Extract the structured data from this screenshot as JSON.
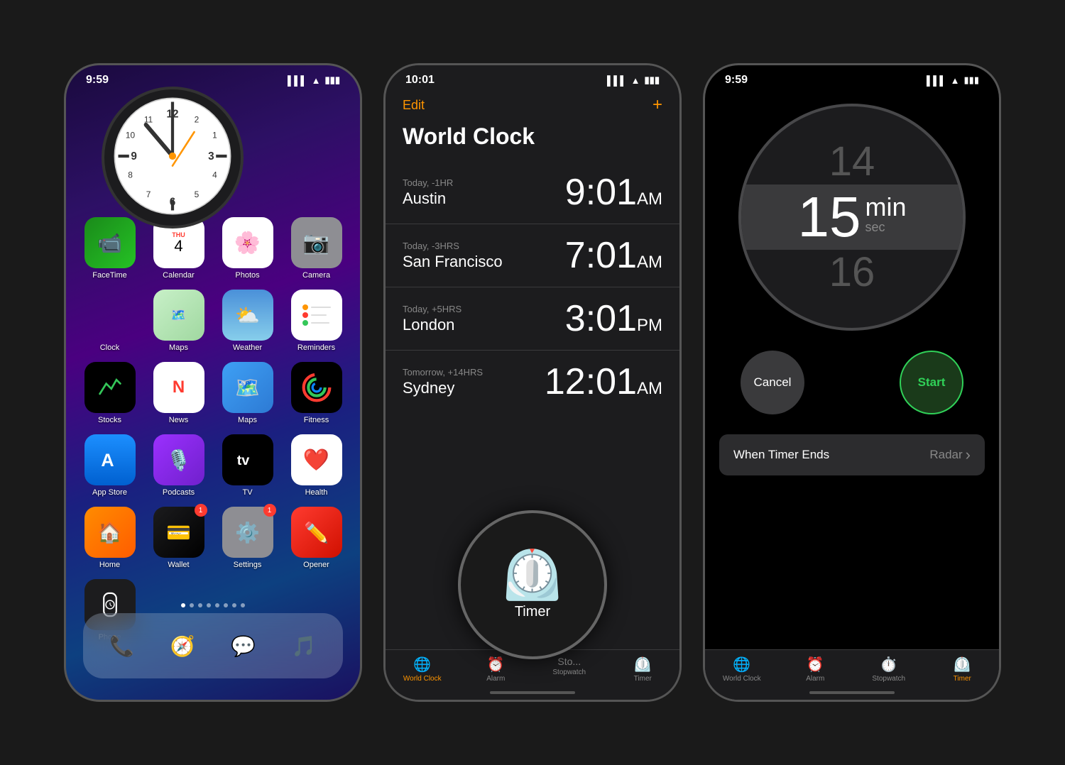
{
  "phone1": {
    "status_bar": {
      "time": "9:59",
      "signal": "●●● ",
      "wifi": "wifi",
      "battery": "battery"
    },
    "apps_row1": [
      {
        "id": "facetime",
        "label": "FaceTime",
        "emoji": "📹",
        "bg": "facetime-bg"
      },
      {
        "id": "calendar",
        "label": "THU\n4",
        "emoji": "📅",
        "bg": "calendar-bg"
      },
      {
        "id": "photos",
        "label": "Photos",
        "emoji": "🖼️",
        "bg": "photos-bg"
      },
      {
        "id": "camera",
        "label": "Camera",
        "emoji": "📷",
        "bg": "camera-bg"
      }
    ],
    "apps_row2": [
      {
        "id": "clock",
        "label": "Clock",
        "emoji": "🕐",
        "bg": "watch-bg"
      },
      {
        "id": "maps2",
        "label": "",
        "emoji": "",
        "bg": "maps-bg"
      },
      {
        "id": "weather",
        "label": "Weather",
        "emoji": "⛅",
        "bg": "weather-bg"
      },
      {
        "id": "reminders",
        "label": "Reminders",
        "emoji": "🔔",
        "bg": "reminders-bg"
      }
    ],
    "apps_row3": [
      {
        "id": "stocks",
        "label": "Stocks",
        "emoji": "📈",
        "bg": "stocks-bg"
      },
      {
        "id": "news",
        "label": "News",
        "emoji": "📰",
        "bg": "news-bg"
      },
      {
        "id": "maps",
        "label": "Maps",
        "emoji": "🗺️",
        "bg": "maps-bg"
      },
      {
        "id": "fitness",
        "label": "Fitness",
        "emoji": "🎯",
        "bg": "fitness-bg"
      }
    ],
    "apps_row4": [
      {
        "id": "appstore",
        "label": "App Store",
        "emoji": "🅰️",
        "bg": "appstore-bg"
      },
      {
        "id": "podcasts",
        "label": "Podcasts",
        "emoji": "🎙️",
        "bg": "podcasts-bg"
      },
      {
        "id": "tv",
        "label": "TV",
        "emoji": "📺",
        "bg": "tv-bg"
      },
      {
        "id": "health",
        "label": "Health",
        "emoji": "❤️",
        "bg": "health-bg"
      }
    ],
    "apps_row5": [
      {
        "id": "home",
        "label": "Home",
        "emoji": "🏠",
        "bg": "home-bg"
      },
      {
        "id": "wallet",
        "label": "Wallet",
        "emoji": "💳",
        "bg": "wallet-bg",
        "badge": "1"
      },
      {
        "id": "settings",
        "label": "Settings",
        "emoji": "⚙️",
        "bg": "settings-bg",
        "badge": "1"
      },
      {
        "id": "opener",
        "label": "Opener",
        "emoji": "✏️",
        "bg": "opener-bg"
      }
    ],
    "apps_row6": [
      {
        "id": "watch",
        "label": "Watch",
        "emoji": "⌚",
        "bg": "watch-bg"
      }
    ],
    "dock": [
      {
        "id": "phone",
        "label": "Phone",
        "emoji": "📞",
        "bg": "phone-bg"
      },
      {
        "id": "safari",
        "label": "Safari",
        "emoji": "🧭",
        "bg": "safari-bg"
      },
      {
        "id": "messages",
        "label": "Messages",
        "emoji": "💬",
        "bg": "messages-bg"
      },
      {
        "id": "music",
        "label": "Music",
        "emoji": "🎵",
        "bg": "music-bg"
      }
    ]
  },
  "phone2": {
    "status_bar": {
      "time": "10:01"
    },
    "nav": {
      "edit": "Edit",
      "plus": "+"
    },
    "title": "World Clock",
    "clocks": [
      {
        "label": "Today, -1HR",
        "city": "Austin",
        "time": "9:01",
        "ampm": "AM"
      },
      {
        "label": "Today, -3HRS",
        "city": "San Francisco",
        "time": "7:01",
        "ampm": "AM"
      },
      {
        "label": "Today, +5HRS",
        "city": "London",
        "time": "3:01",
        "ampm": "PM"
      },
      {
        "label": "Tomorrow, +14HRS",
        "city": "Sydney",
        "time": "12:01",
        "ampm": "AM"
      }
    ],
    "tabs": [
      {
        "id": "world-clock",
        "icon": "🌐",
        "label": "World Clock",
        "active": true
      },
      {
        "id": "alarm",
        "icon": "⏰",
        "label": "Alarm",
        "active": false
      },
      {
        "id": "stopwatch",
        "icon": "⏱️",
        "label": "Stopwatch",
        "active": false
      },
      {
        "id": "timer",
        "icon": "⏲️",
        "label": "Timer",
        "active": false
      }
    ]
  },
  "timer_circle": {
    "icon": "⏲️",
    "label": "Timer"
  },
  "phone3": {
    "status_bar": {
      "time": "9:59"
    },
    "timer": {
      "num_above": "14",
      "num_current": "15",
      "unit": "min",
      "unit_small": "sec",
      "num_below": "16"
    },
    "buttons": {
      "cancel": "Cancel",
      "start": "Start"
    },
    "when_timer_ends": {
      "label": "When Timer Ends",
      "value": "Radar",
      "chevron": "›"
    },
    "tabs": [
      {
        "id": "world-clock",
        "icon": "🌐",
        "label": "World Clock",
        "active": false
      },
      {
        "id": "alarm",
        "icon": "⏰",
        "label": "Alarm",
        "active": false
      },
      {
        "id": "stopwatch",
        "icon": "⏱️",
        "label": "Stopwatch",
        "active": false
      },
      {
        "id": "timer",
        "icon": "⏲️",
        "label": "Timer",
        "active": true
      }
    ]
  }
}
